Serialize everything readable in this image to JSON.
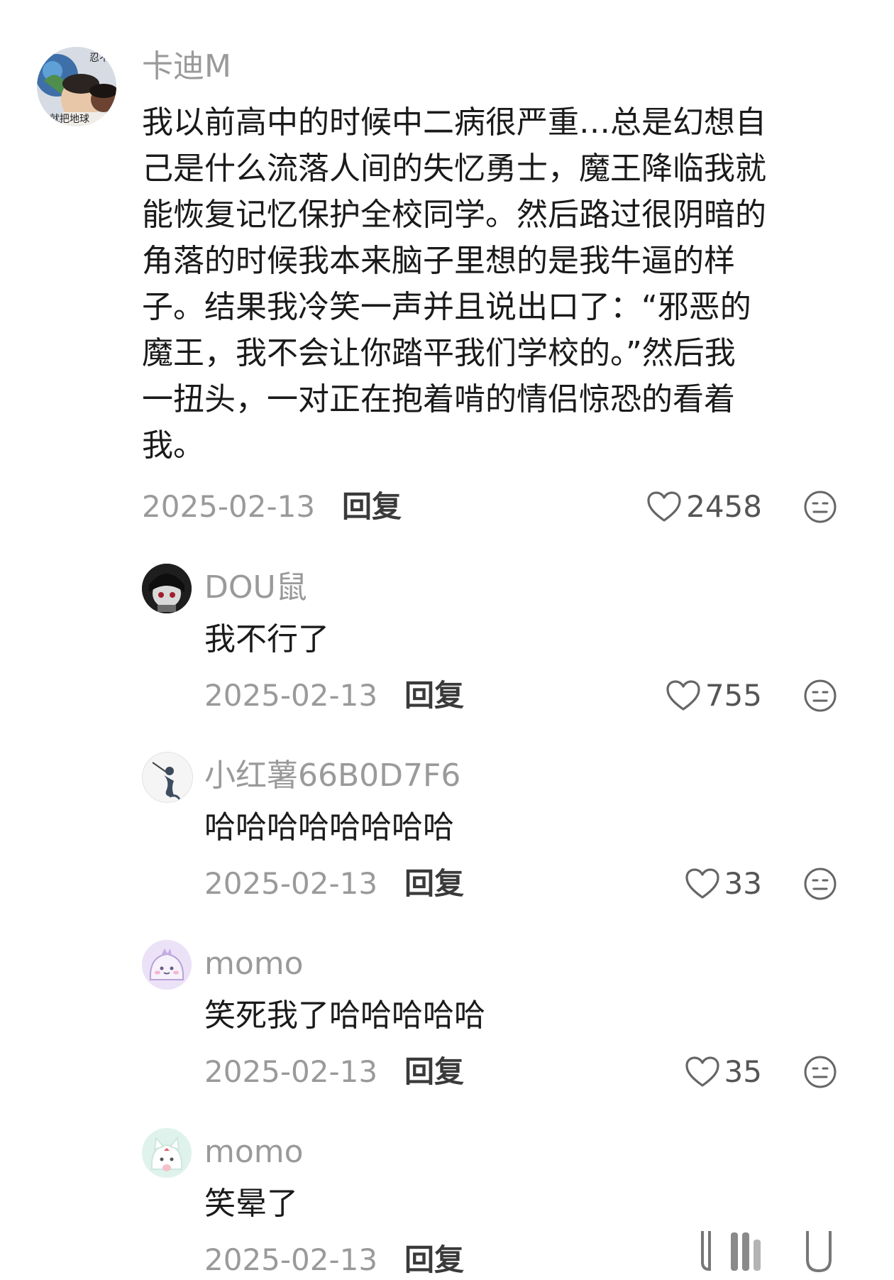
{
  "comments": [
    {
      "user": "卡迪M",
      "lines": [
        "我以前高中的时候中二病很严重…总是幻想自",
        "己是什么流落人间的失忆勇士，魔王降临我就",
        "能恢复记忆保护全校同学。然后路过很阴暗的",
        "角落的时候我本来脑子里想的是我牛逼的样",
        "子。结果我冷笑一声并且说出口了：“邪恶的",
        "魔王，我不会让你踏平我们学校的。”然后我",
        "一扭头，一对正在抱着啃的情侣惊恐的看着",
        "我。"
      ],
      "avatar_text": [
        "忍不",
        "就把地球"
      ],
      "date": "2025-02-13",
      "reply": "回复",
      "likes": "2458"
    },
    {
      "user": "DOU鼠",
      "text": "我不行了",
      "date": "2025-02-13",
      "reply": "回复",
      "likes": "755"
    },
    {
      "user": "小红薯66B0D7F6",
      "text": "哈哈哈哈哈哈哈哈",
      "date": "2025-02-13",
      "reply": "回复",
      "likes": "33"
    },
    {
      "user": "momo",
      "text": "笑死我了哈哈哈哈哈",
      "date": "2025-02-13",
      "reply": "回复",
      "likes": "35"
    },
    {
      "user": "momo",
      "text": "笑晕了",
      "date": "2025-02-13",
      "reply": "回复"
    }
  ],
  "icons": {
    "like": "heart-outline-icon",
    "dislike": "neutral-face-icon"
  },
  "colors": {
    "username": "#9a9a9a",
    "text": "#1a1a1a",
    "meta": "#9a9a9a"
  }
}
